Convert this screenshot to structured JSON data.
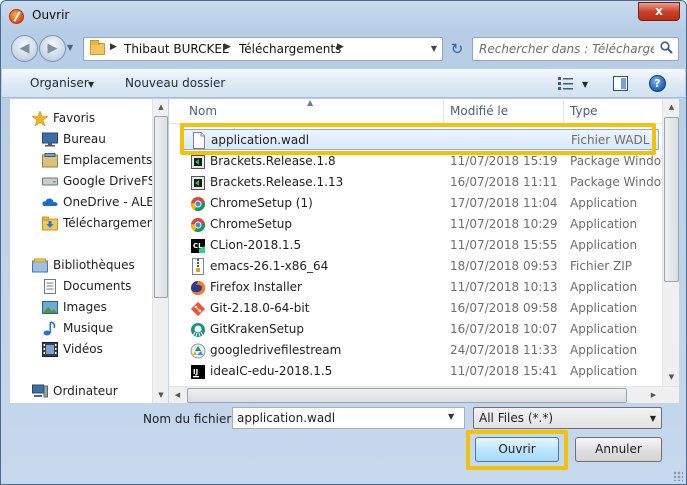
{
  "window": {
    "title": "Ouvrir",
    "close_label": "x"
  },
  "address": {
    "crumbs": [
      "Thibaut BURCKEL",
      "Téléchargements"
    ],
    "search_placeholder": "Rechercher dans : Télécharge..."
  },
  "toolbar": {
    "organize_label": "Organiser",
    "new_folder_label": "Nouveau dossier",
    "help_label": "?"
  },
  "sidebar": {
    "items": [
      {
        "label": "Favoris",
        "icon": "star-icon",
        "indent": 0
      },
      {
        "label": "Bureau",
        "icon": "desktop-icon",
        "indent": 1
      },
      {
        "label": "Emplacements récents",
        "icon": "recent-places-icon",
        "indent": 1
      },
      {
        "label": "Google DriveFS",
        "icon": "drive-icon",
        "indent": 1
      },
      {
        "label": "OneDrive - ALE International",
        "icon": "onedrive-icon",
        "indent": 1
      },
      {
        "label": "Téléchargements",
        "icon": "downloads-folder-icon",
        "indent": 1
      },
      {
        "label": "Bibliothèques",
        "icon": "libraries-icon",
        "indent": 0
      },
      {
        "label": "Documents",
        "icon": "documents-icon",
        "indent": 1
      },
      {
        "label": "Images",
        "icon": "images-icon",
        "indent": 1
      },
      {
        "label": "Musique",
        "icon": "music-icon",
        "indent": 1
      },
      {
        "label": "Vidéos",
        "icon": "videos-icon",
        "indent": 1
      },
      {
        "label": "Ordinateur",
        "icon": "computer-icon",
        "indent": 0
      }
    ]
  },
  "columns": {
    "name": "Nom",
    "date": "Modifié le",
    "type": "Type"
  },
  "files": [
    {
      "name": "application.wadl",
      "date": "",
      "type": "Fichier WADL",
      "icon": "blank-file-icon",
      "selected": true
    },
    {
      "name": "Brackets.Release.1.8",
      "date": "11/07/2018 15:19",
      "type": "Package Windows",
      "icon": "installer-icon"
    },
    {
      "name": "Brackets.Release.1.13",
      "date": "16/07/2018 11:11",
      "type": "Package Windows",
      "icon": "installer-icon"
    },
    {
      "name": "ChromeSetup (1)",
      "date": "17/07/2018 11:04",
      "type": "Application",
      "icon": "chrome-icon"
    },
    {
      "name": "ChromeSetup",
      "date": "11/07/2018 10:29",
      "type": "Application",
      "icon": "chrome-icon"
    },
    {
      "name": "CLion-2018.1.5",
      "date": "11/07/2018 15:55",
      "type": "Application",
      "icon": "clion-icon"
    },
    {
      "name": "emacs-26.1-x86_64",
      "date": "18/07/2018 09:53",
      "type": "Fichier ZIP",
      "icon": "zip-icon"
    },
    {
      "name": "Firefox Installer",
      "date": "11/07/2018 10:13",
      "type": "Application",
      "icon": "firefox-icon"
    },
    {
      "name": "Git-2.18.0-64-bit",
      "date": "16/07/2018 09:58",
      "type": "Application",
      "icon": "git-icon"
    },
    {
      "name": "GitKrakenSetup",
      "date": "16/07/2018 10:07",
      "type": "Application",
      "icon": "gitkraken-icon"
    },
    {
      "name": "googledrivefilestream",
      "date": "24/07/2018 11:33",
      "type": "Application",
      "icon": "google-drive-icon"
    },
    {
      "name": "ideaIC-edu-2018.1.5",
      "date": "11/07/2018 15:41",
      "type": "Application",
      "icon": "intellij-icon"
    }
  ],
  "bottom": {
    "filename_label": "Nom du fichier :",
    "filename_value": "application.wadl",
    "filter_value": "All Files (*.*)",
    "open_label": "Ouvrir",
    "cancel_label": "Annuler"
  },
  "colors": {
    "highlight": "#f2c20b",
    "selection_border": "#84acdd"
  }
}
